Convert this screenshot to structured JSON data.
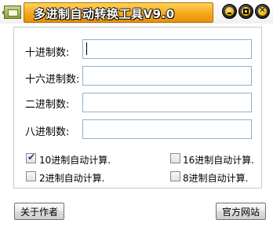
{
  "window": {
    "title": "多进制自动转换工具V9.0",
    "minimize_glyph": "",
    "maximize_glyph": "",
    "close_glyph": "✕"
  },
  "fields": [
    {
      "label": "十进制数:",
      "value": ""
    },
    {
      "label": "十六进制数:",
      "value": ""
    },
    {
      "label": "二进制数:",
      "value": ""
    },
    {
      "label": "八进制数:",
      "value": ""
    }
  ],
  "options": [
    {
      "label": "10进制自动计算.",
      "checked": true
    },
    {
      "label": "16进制自动计算.",
      "checked": false
    },
    {
      "label": "2进制自动计算.",
      "checked": false
    },
    {
      "label": "8进制自动计算.",
      "checked": false
    }
  ],
  "buttons": {
    "about": "关于作者",
    "website": "官方网站"
  },
  "icons": {
    "app": "converter-app-icon",
    "minimize": "minimize-icon",
    "maximize": "maximize-icon",
    "close": "close-icon",
    "checkmark": "checkmark-icon"
  }
}
